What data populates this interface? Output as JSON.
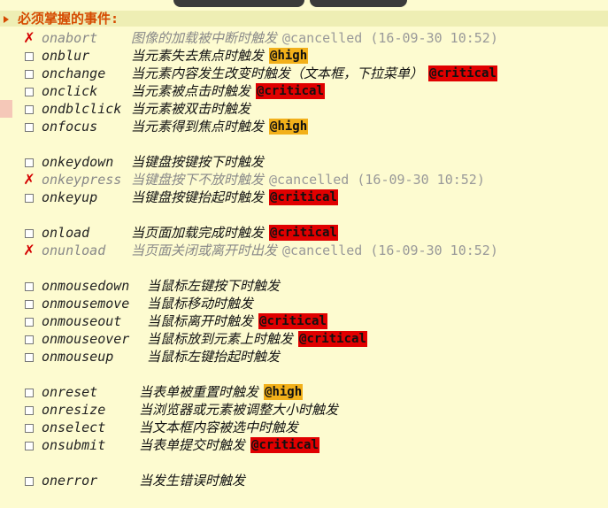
{
  "header": {
    "title": "必须掌握的事件:"
  },
  "colors": {
    "header_text": "#d54a00",
    "high": "#f2b01a",
    "critical": "#e00000",
    "background": "#fdfbd0"
  },
  "rows": [
    {
      "event": "onabort",
      "desc": "图像的加载被中断时触发",
      "status": "cancelled",
      "note": "@cancelled (16-09-30 10:52)"
    },
    {
      "event": "onblur",
      "desc": "当元素失去焦点时触发",
      "status": "open",
      "tag": "@high"
    },
    {
      "event": "onchange",
      "desc": "当元素内容发生改变时触发（文本框，下拉菜单）",
      "status": "open",
      "tag": "@critical"
    },
    {
      "event": "onclick",
      "desc": "当元素被点击时触发",
      "status": "open",
      "tag": "@critical"
    },
    {
      "event": "ondblclick",
      "desc": "当元素被双击时触发",
      "status": "open"
    },
    {
      "event": "onfocus",
      "desc": "当元素得到焦点时触发",
      "status": "open",
      "tag": "@high"
    },
    {
      "event": "onkeydown",
      "desc": "当键盘按键按下时触发",
      "status": "open"
    },
    {
      "event": "onkeypress",
      "desc": "当键盘按下不放时触发",
      "status": "cancelled",
      "note": "@cancelled (16-09-30 10:52)"
    },
    {
      "event": "onkeyup",
      "desc": "当键盘按键抬起时触发",
      "status": "open",
      "tag": "@critical"
    },
    {
      "event": "onload",
      "desc": "当页面加载完成时触发",
      "status": "open",
      "tag": "@critical"
    },
    {
      "event": "onunload",
      "desc": "当页面关闭或离开时出发",
      "status": "cancelled",
      "note": "@cancelled (16-09-30 10:52)"
    },
    {
      "event": "onmousedown",
      "desc": "当鼠标左键按下时触发",
      "status": "open"
    },
    {
      "event": "onmousemove",
      "desc": "当鼠标移动时触发",
      "status": "open"
    },
    {
      "event": "onmouseout",
      "desc": "当鼠标离开时触发",
      "status": "open",
      "tag": "@critical"
    },
    {
      "event": "onmouseover",
      "desc": "当鼠标放到元素上时触发",
      "status": "open",
      "tag": "@critical"
    },
    {
      "event": "onmouseup",
      "desc": "当鼠标左键抬起时触发",
      "status": "open"
    },
    {
      "event": "onreset",
      "desc": "当表单被重置时触发",
      "status": "open",
      "tag": "@high"
    },
    {
      "event": "onresize",
      "desc": "当浏览器或元素被调整大小时触发",
      "status": "open"
    },
    {
      "event": "onselect",
      "desc": "当文本框内容被选中时触发",
      "status": "open"
    },
    {
      "event": "onsubmit",
      "desc": "当表单提交时触发",
      "status": "open",
      "tag": "@critical"
    },
    {
      "event": "onerror",
      "desc": "当发生错误时触发",
      "status": "open"
    }
  ]
}
